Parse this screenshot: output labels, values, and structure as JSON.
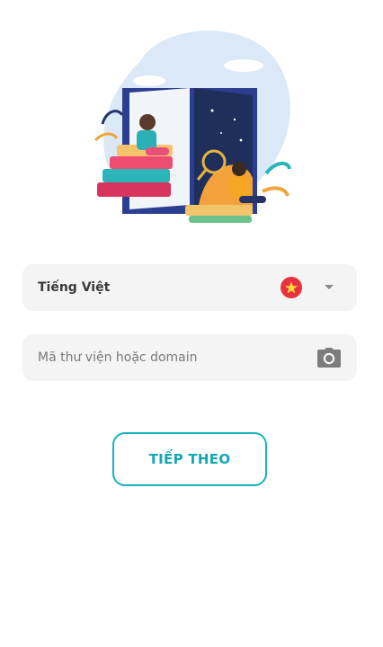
{
  "language_select": {
    "value": "Tiếng Việt",
    "flag_icon": "vietnam-flag-icon",
    "dropdown_icon": "caret-down-icon"
  },
  "library_field": {
    "placeholder": "Mã thư viện hoặc domain",
    "value": "",
    "scan_icon": "camera-icon"
  },
  "next_button": {
    "label": "TIẾP THEO"
  },
  "colors": {
    "accent": "#1ab0bd",
    "field_background": "#f4f4f4",
    "flag_red": "#e8323f",
    "flag_star": "#ffd93b"
  }
}
